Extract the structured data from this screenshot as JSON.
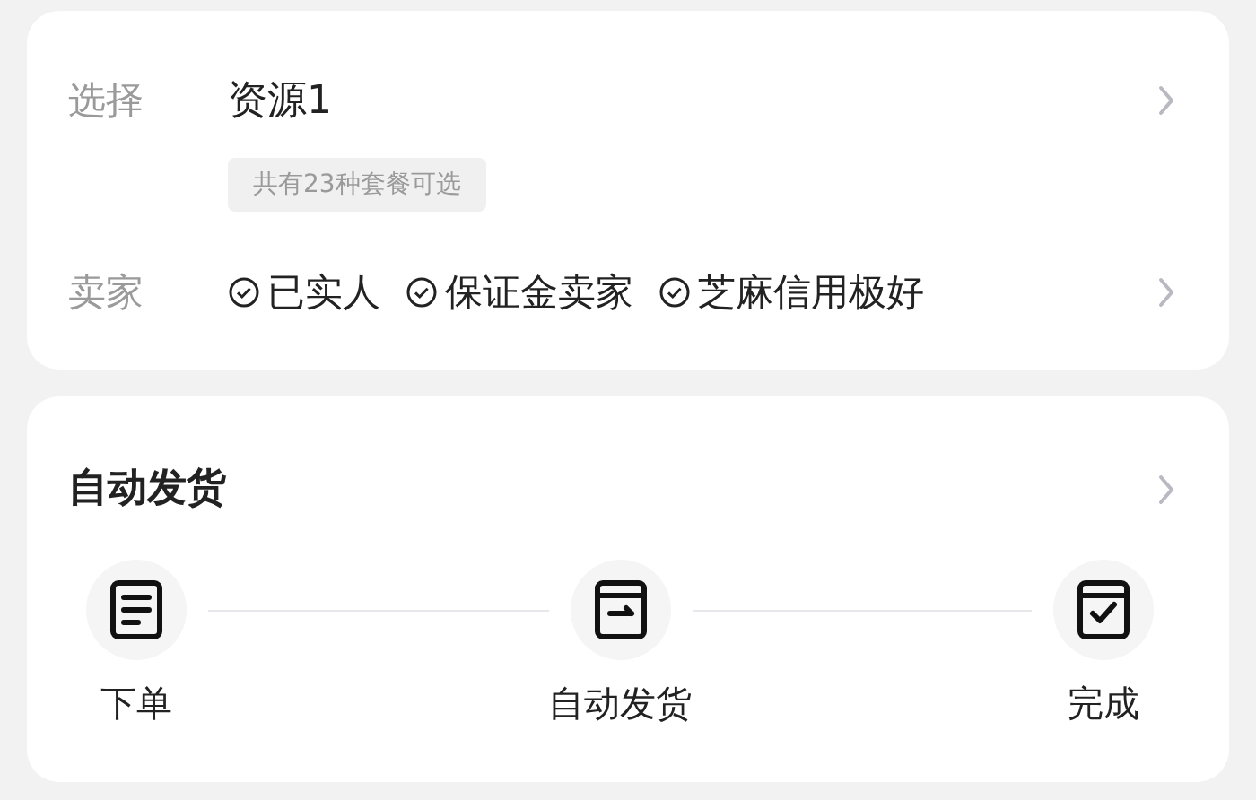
{
  "selection": {
    "label": "选择",
    "value": "资源1",
    "hint": "共有23种套餐可选"
  },
  "seller": {
    "label": "卖家",
    "badges": [
      "已实人",
      "保证金卖家",
      "芝麻信用极好"
    ]
  },
  "delivery": {
    "title": "自动发货",
    "steps": [
      {
        "kind": "order",
        "label": "下单"
      },
      {
        "kind": "ship",
        "label": "自动发货"
      },
      {
        "kind": "done",
        "label": "完成"
      }
    ]
  }
}
